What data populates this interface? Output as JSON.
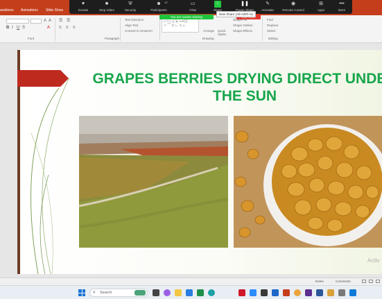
{
  "ribbon_tabs": [
    "ansitions",
    "Animations",
    "Slide Show"
  ],
  "zoom_toolbar": {
    "buttons": [
      {
        "name": "donate",
        "label": "Donate",
        "icon": "heart-icon"
      },
      {
        "name": "stop-video",
        "label": "Stop Video",
        "icon": "camera-icon"
      },
      {
        "name": "security",
        "label": "Security",
        "icon": "shield-icon"
      },
      {
        "name": "participants",
        "label": "Participants",
        "icon": "people-icon",
        "count": "67"
      },
      {
        "name": "chat",
        "label": "Chat",
        "icon": "chat-icon"
      },
      {
        "name": "share",
        "label": "Share",
        "icon": "share-arrow-icon"
      },
      {
        "name": "pause-share",
        "label": "Pause Share",
        "icon": "pause-icon"
      },
      {
        "name": "annotate",
        "label": "Annotate",
        "icon": "pen-icon"
      },
      {
        "name": "remote-control",
        "label": "Remote Control",
        "icon": "mouse-icon"
      },
      {
        "name": "apps",
        "label": "Apps",
        "icon": "apps-icon"
      },
      {
        "name": "more",
        "label": "More",
        "icon": "dots-icon"
      }
    ],
    "share_banner": "You are screen sharing",
    "stop_share": "Stop Share",
    "tooltip": "New Share (Alt+Shift+S)"
  },
  "ribbon": {
    "groups": [
      "Font",
      "Paragraph",
      "Drawing",
      "Editing"
    ],
    "paragraph_items": [
      "Text Direction",
      "Align Text",
      "Convert to SmartArt"
    ],
    "drawing_items": [
      "Arrange",
      "Quick Styles",
      "Shape Fill",
      "Shape Outline",
      "Shape Effects"
    ],
    "editing_items": [
      "Find",
      "Replace",
      "Select"
    ]
  },
  "slide": {
    "title": "GRAPES BERRIES DRYING DIRECT UNDER THE SUN",
    "watermark": "Activ"
  },
  "status_bar": {
    "notes": "Notes",
    "comments": "Comments"
  },
  "taskbar": {
    "search_placeholder": "Search"
  },
  "colors": {
    "ribbon_accent": "#c43e1c",
    "title_green": "#17a54b",
    "arrow_red": "#bf2a1e",
    "zoom_share_green": "#23c940",
    "zoom_stop_red": "#e3352d"
  }
}
